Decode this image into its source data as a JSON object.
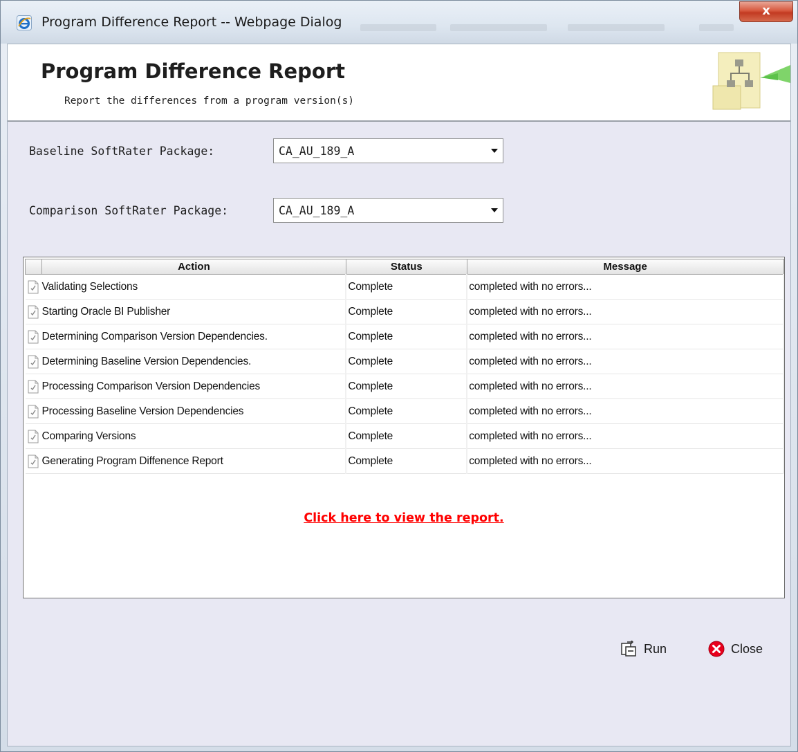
{
  "window": {
    "title": "Program Difference Report -- Webpage Dialog",
    "close_glyph": "x",
    "app_icon": "internet-explorer-icon"
  },
  "header": {
    "title": "Program Difference Report",
    "subtitle": "Report the differences from a program version(s)",
    "graphic": "hierarchy-diagram-icon"
  },
  "form": {
    "baseline_label": "Baseline SoftRater Package:",
    "baseline_value": "CA_AU_189_A",
    "comparison_label": "Comparison SoftRater Package:",
    "comparison_value": "CA_AU_189_A"
  },
  "grid": {
    "columns": [
      "Action",
      "Status",
      "Message"
    ],
    "rows": [
      {
        "action": "Validating Selections",
        "status": "Complete",
        "message": "completed with no errors..."
      },
      {
        "action": "Starting Oracle BI Publisher",
        "status": "Complete",
        "message": "completed with no errors..."
      },
      {
        "action": "Determining Comparison Version Dependencies.",
        "status": "Complete",
        "message": "completed with no errors..."
      },
      {
        "action": "Determining Baseline Version Dependencies.",
        "status": "Complete",
        "message": "completed with no errors..."
      },
      {
        "action": "Processing Comparison Version Dependencies",
        "status": "Complete",
        "message": "completed with no errors..."
      },
      {
        "action": "Processing Baseline Version Dependencies",
        "status": "Complete",
        "message": "completed with no errors..."
      },
      {
        "action": "Comparing Versions",
        "status": "Complete",
        "message": "completed with no errors..."
      },
      {
        "action": "Generating Program Diffenence Report",
        "status": "Complete",
        "message": "completed with no errors..."
      }
    ],
    "row_icon": "document-check-icon"
  },
  "link": {
    "text": "Click here to view the report.",
    "color": "#ff0000"
  },
  "buttons": {
    "run_label": "Run",
    "run_icon": "run-report-icon",
    "close_label": "Close",
    "close_icon": "close-circle-icon",
    "close_icon_color": "#e8001c"
  }
}
